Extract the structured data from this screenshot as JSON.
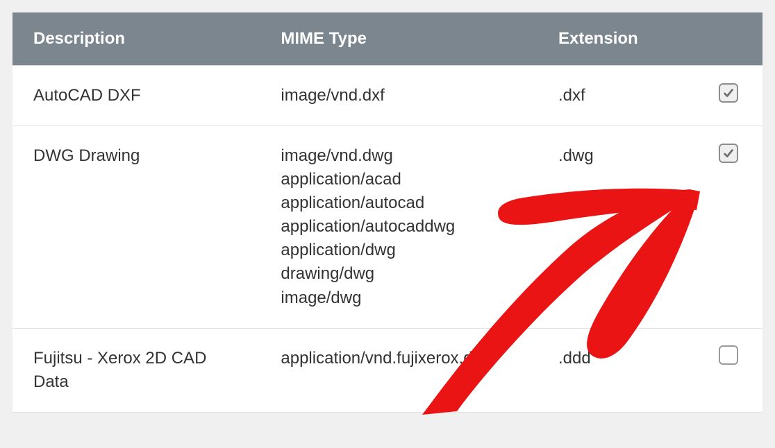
{
  "headers": {
    "description": "Description",
    "mime": "MIME Type",
    "extension": "Extension"
  },
  "rows": [
    {
      "description": "AutoCAD DXF",
      "mimes": [
        "image/vnd.dxf"
      ],
      "extension": ".dxf",
      "checked": true
    },
    {
      "description": "DWG Drawing",
      "mimes": [
        "image/vnd.dwg",
        "application/acad",
        "application/autocad",
        "application/autocaddwg",
        "application/dwg",
        "drawing/dwg",
        "image/dwg"
      ],
      "extension": ".dwg",
      "checked": true
    },
    {
      "description": "Fujitsu - Xerox 2D CAD Data",
      "mimes": [
        "application/vnd.fujixerox.ddd"
      ],
      "extension": ".ddd",
      "checked": false
    }
  ],
  "annotation": {
    "color": "#ea1414"
  }
}
